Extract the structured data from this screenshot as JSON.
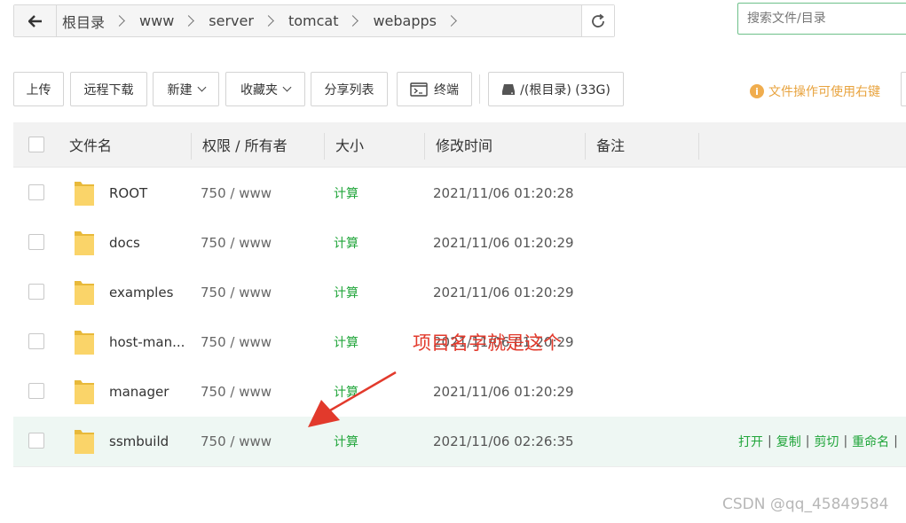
{
  "breadcrumb": [
    "根目录",
    "www",
    "server",
    "tomcat",
    "webapps"
  ],
  "search": {
    "placeholder": "搜索文件/目录"
  },
  "toolbar": {
    "upload": "上传",
    "remote_download": "远程下载",
    "new": "新建",
    "favorites": "收藏夹",
    "share_list": "分享列表",
    "terminal": "终端",
    "disk": "/(根目录) (33G)",
    "hint": "文件操作可使用右键"
  },
  "table": {
    "headers": {
      "name": "文件名",
      "perm": "权限 / 所有者",
      "size": "大小",
      "mtime": "修改时间",
      "note": "备注"
    },
    "rows": [
      {
        "name": "ROOT",
        "perm": "750 / www",
        "size": "计算",
        "mtime": "2021/11/06 01:20:28"
      },
      {
        "name": "docs",
        "perm": "750 / www",
        "size": "计算",
        "mtime": "2021/11/06 01:20:29"
      },
      {
        "name": "examples",
        "perm": "750 / www",
        "size": "计算",
        "mtime": "2021/11/06 01:20:29"
      },
      {
        "name": "host-man...",
        "perm": "750 / www",
        "size": "计算",
        "mtime": "2021/11/06 01:20:29"
      },
      {
        "name": "manager",
        "perm": "750 / www",
        "size": "计算",
        "mtime": "2021/11/06 01:20:29"
      },
      {
        "name": "ssmbuild",
        "perm": "750 / www",
        "size": "计算",
        "mtime": "2021/11/06 02:26:35"
      }
    ],
    "row_actions": [
      "打开",
      "复制",
      "剪切",
      "重命名"
    ]
  },
  "annotation": "项目名字就是这个",
  "watermark": "CSDN @qq_45849584",
  "colors": {
    "accent_green": "#20a53a",
    "hint_orange": "#e8a33e",
    "annotation_red": "#e23a2c",
    "selected_row": "#eef7f3"
  }
}
